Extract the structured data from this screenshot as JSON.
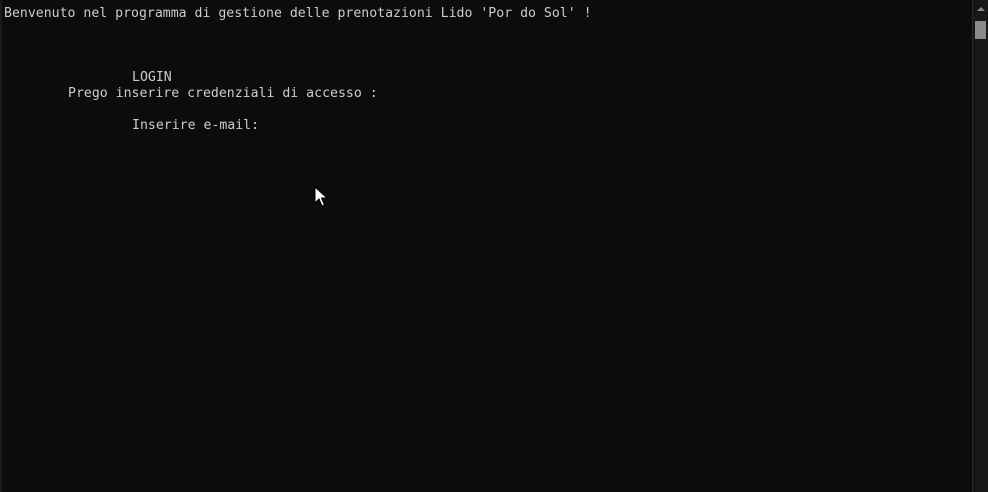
{
  "console": {
    "lines": {
      "welcome": "Benvenuto nel programma di gestione delle prenotazioni Lido 'Por do Sol' !",
      "login_title": "LOGIN",
      "credentials_prompt": "Prego inserire credenziali di accesso :",
      "email_prompt": "Inserire e-mail:"
    }
  },
  "icons": {
    "scroll_up": "chevron-up-icon",
    "pointer": "mouse-pointer-icon"
  },
  "colors": {
    "background": "#0c0c0c",
    "text": "#cccccc",
    "scrollbar": "#171717",
    "scroll_thumb": "#8a8a8a"
  }
}
